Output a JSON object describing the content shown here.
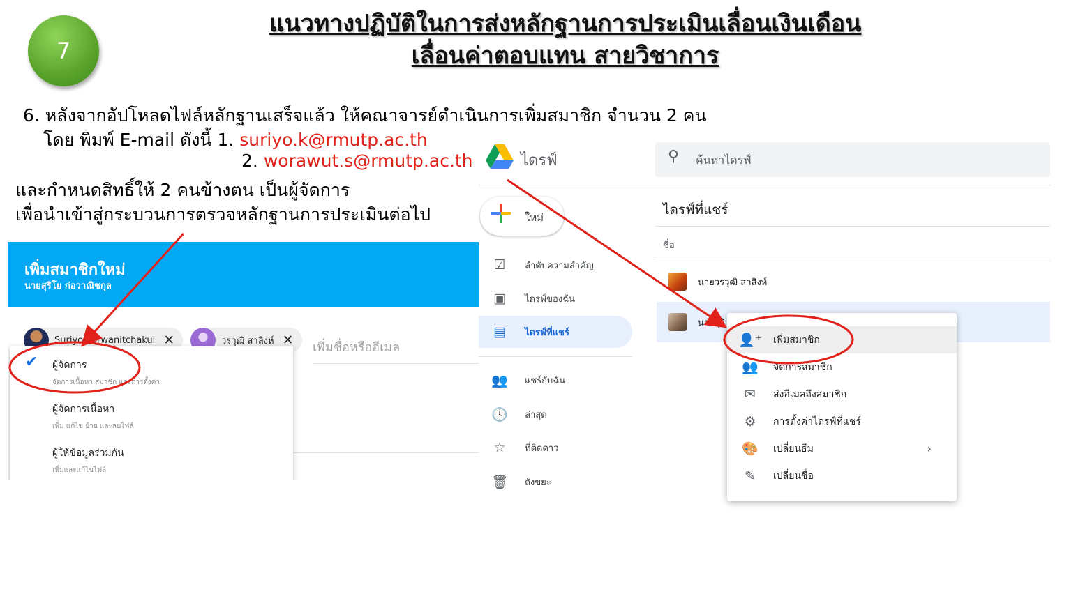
{
  "slide": {
    "number": "7",
    "title_line1": "แนวทางปฏิบัติในการส่งหลักฐานการประเมินเลื่อนเงินเดือน",
    "title_line2": "เลื่อนค่าตอบแทน สายวิชาการ",
    "instruction_line1": "6. หลังจากอัปโหลดไฟล์หลักฐานเสร็จแล้ว ให้คณาจารย์ดำเนินการเพิ่มสมาชิก จำนวน 2 คน",
    "instruction_line2_prefix": "โดย พิมพ์ E-mail ดังนี้  1. ",
    "email1": "suriyo.k@rmutp.ac.th",
    "email2_prefix": "2. ",
    "email2": "worawut.s@rmutp.ac.th",
    "instruction_line3": "และกำหนดสิทธิ์ให้ 2 คนข้างตน เป็นผู้จัดการ",
    "instruction_line4": "เพื่อนำเข้าสู่กระบวนการตรวจหลักฐานการประเมินต่อไป",
    "colors": {
      "highlight_red": "#e0221b",
      "accent_blue": "#03a9f4",
      "circle_green": "#5aa32b"
    }
  },
  "add_member_dialog": {
    "title": "เพิ่มสมาชิกใหม่",
    "subtitle": "นายสุริโย ก่อวาณิชกุล",
    "chips": [
      {
        "label": "Suriyo Korwanitchakul",
        "remove": "✕"
      },
      {
        "label": "วรวุฒิ สาลิงห์",
        "remove": "✕"
      }
    ],
    "input_placeholder": "เพิ่มชื่อหรืออีเมล",
    "roles": [
      {
        "name": "ผู้จัดการ",
        "desc": "จัดการเนื้อหา สมาชิก และการตั้งค่า",
        "selected": true
      },
      {
        "name": "ผู้จัดการเนื้อหา",
        "desc": "เพิ่ม แก้ไข ย้าย และลบไฟล์",
        "selected": false
      },
      {
        "name": "ผู้ให้ข้อมูลร่วมกัน",
        "desc": "เพิ่มและแก้ไขไฟล์",
        "selected": false
      }
    ]
  },
  "drive": {
    "app_title": "ไดรฟ์",
    "search_placeholder": "ค้นหาไดรฟ์",
    "new_button": "ใหม่",
    "nav": [
      {
        "label": "ลำดับความสำคัญ",
        "icon": "priority-icon"
      },
      {
        "label": "ไดรฟ์ของฉัน",
        "icon": "my-drive-icon"
      },
      {
        "label": "ไดรฟ์ที่แชร์",
        "icon": "shared-drives-icon",
        "selected": true
      },
      {
        "label": "แชร์กับฉัน",
        "icon": "shared-with-me-icon"
      },
      {
        "label": "ล่าสุด",
        "icon": "recent-icon"
      },
      {
        "label": "ที่ติดดาว",
        "icon": "starred-icon"
      },
      {
        "label": "ถังขยะ",
        "icon": "trash-icon"
      }
    ],
    "list_title": "ไดรฟ์ที่แชร์",
    "column_name": "ชื่อ",
    "rows": [
      {
        "name": "นายวรวุฒิ สาลิงห์"
      },
      {
        "name": "นายสุริ"
      }
    ],
    "context_menu": [
      {
        "label": "เพิ่มสมาชิก",
        "icon": "add-member-icon"
      },
      {
        "label": "จัดการสมาชิก",
        "icon": "manage-members-icon"
      },
      {
        "label": "ส่งอีเมลถึงสมาชิก",
        "icon": "email-icon"
      },
      {
        "label": "การตั้งค่าไดรฟ์ที่แชร์",
        "icon": "settings-icon"
      },
      {
        "label": "เปลี่ยนธีม",
        "icon": "palette-icon",
        "submenu": "›"
      },
      {
        "label": "เปลี่ยนชื่อ",
        "icon": "rename-icon"
      }
    ]
  }
}
